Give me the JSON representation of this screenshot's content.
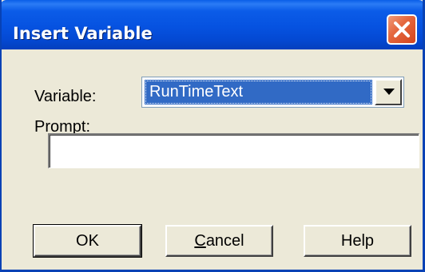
{
  "window": {
    "title": "Insert Variable"
  },
  "icons": {
    "close": "close-icon",
    "dropdown": "chevron-down-icon"
  },
  "colors": {
    "titlebar": "#0652e0",
    "dialog_background": "#ece9d8",
    "selection_highlight": "#316ac5",
    "close_button": "#e5683f"
  },
  "form": {
    "variable_label": "Variable:",
    "variable_value": "RunTimeText",
    "prompt_label": "Prompt:",
    "prompt_value": ""
  },
  "buttons": {
    "ok_label": "OK",
    "cancel_first_char": "C",
    "cancel_rest": "ancel",
    "help_label": "Help"
  }
}
